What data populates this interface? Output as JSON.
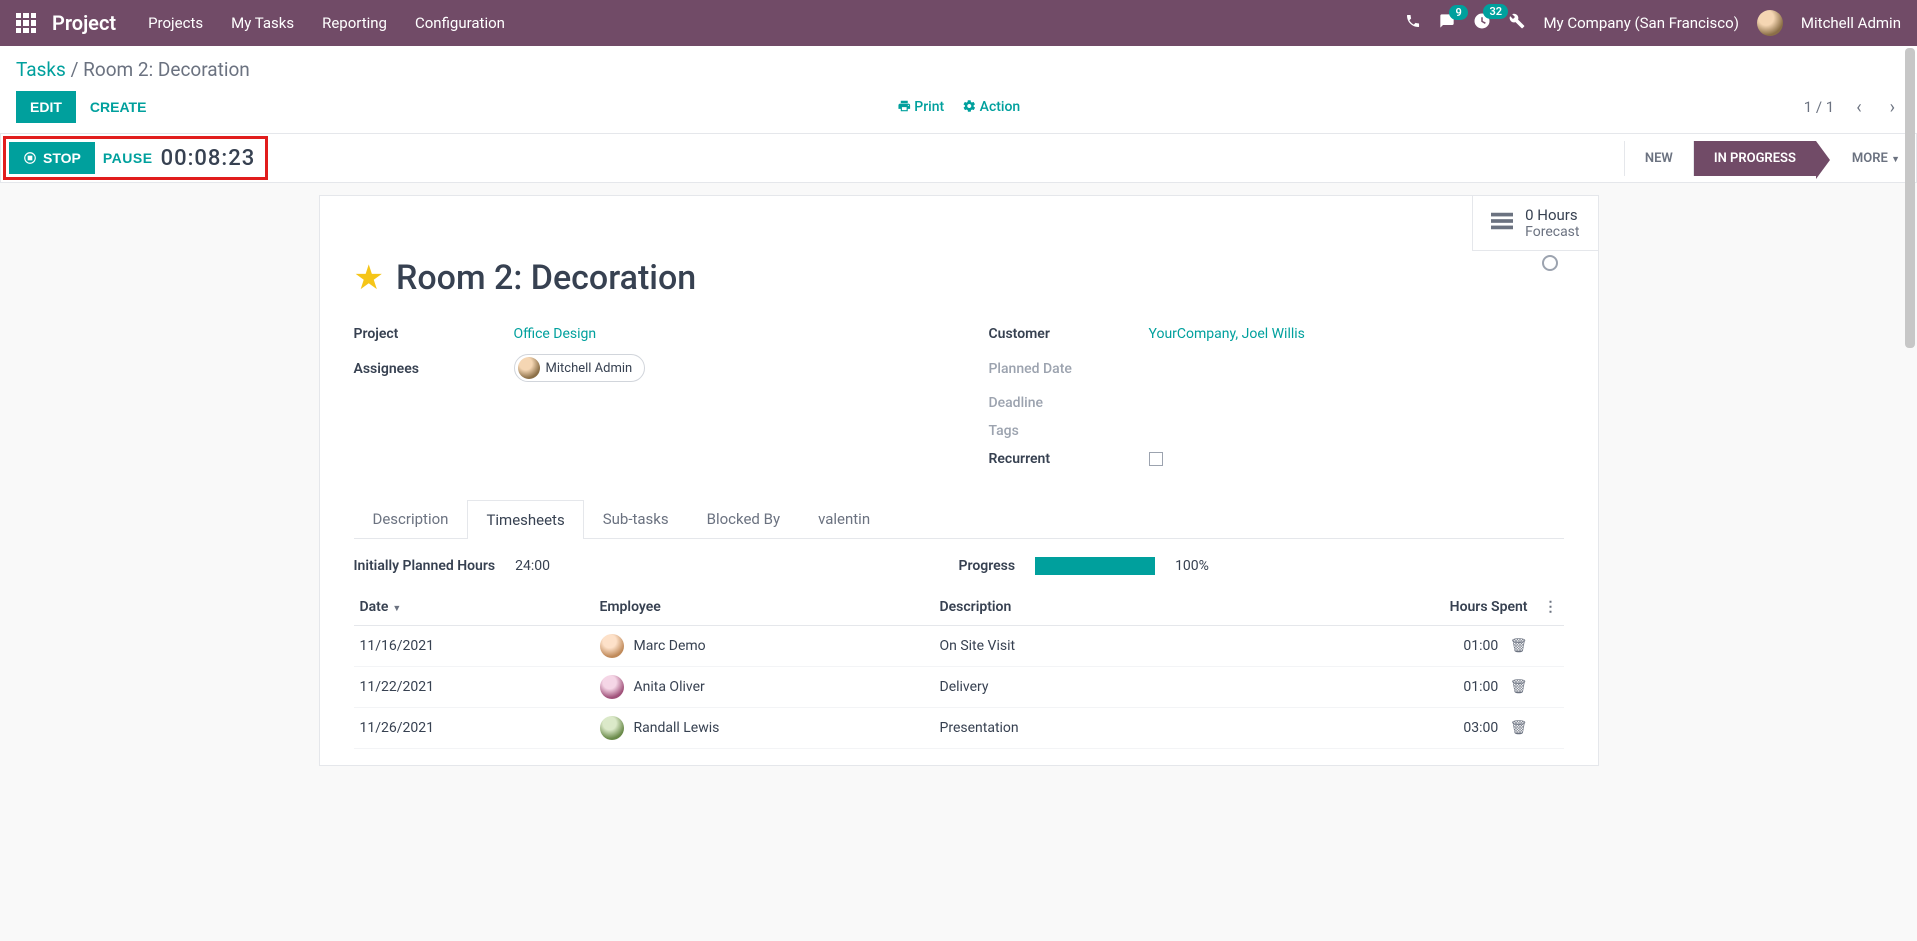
{
  "topnav": {
    "brand": "Project",
    "menu": [
      "Projects",
      "My Tasks",
      "Reporting",
      "Configuration"
    ],
    "discuss_badge": "9",
    "activity_badge": "32",
    "company": "My Company (San Francisco)",
    "user": "Mitchell Admin"
  },
  "breadcrumb": {
    "parent": "Tasks",
    "current": "Room 2: Decoration"
  },
  "buttons": {
    "edit": "EDIT",
    "create": "CREATE",
    "print": "Print",
    "action": "Action",
    "stop": "STOP",
    "pause": "PAUSE"
  },
  "pager": "1 / 1",
  "timer": "00:08:23",
  "stages": {
    "new": "NEW",
    "in_progress": "IN PROGRESS",
    "more": "MORE"
  },
  "statbtn": {
    "value": "0  Hours",
    "label": "Forecast"
  },
  "task": {
    "title": "Room 2: Decoration",
    "labels": {
      "project": "Project",
      "assignees": "Assignees",
      "customer": "Customer",
      "planned_date": "Planned Date",
      "deadline": "Deadline",
      "tags": "Tags",
      "recurrent": "Recurrent"
    },
    "project": "Office Design",
    "assignee": "Mitchell Admin",
    "customer": "YourCompany, Joel Willis"
  },
  "tabs": [
    "Description",
    "Timesheets",
    "Sub-tasks",
    "Blocked By",
    "valentin"
  ],
  "active_tab": 1,
  "timesheet": {
    "planned_label": "Initially Planned Hours",
    "planned_value": "24:00",
    "progress_label": "Progress",
    "progress_pct": "100%",
    "headers": {
      "date": "Date",
      "employee": "Employee",
      "description": "Description",
      "hours": "Hours Spent"
    },
    "rows": [
      {
        "date": "11/16/2021",
        "employee": "Marc Demo",
        "av": "av1",
        "desc": "On Site Visit",
        "hours": "01:00"
      },
      {
        "date": "11/22/2021",
        "employee": "Anita Oliver",
        "av": "av2",
        "desc": "Delivery",
        "hours": "01:00"
      },
      {
        "date": "11/26/2021",
        "employee": "Randall Lewis",
        "av": "av3",
        "desc": "Presentation",
        "hours": "03:00"
      }
    ]
  }
}
